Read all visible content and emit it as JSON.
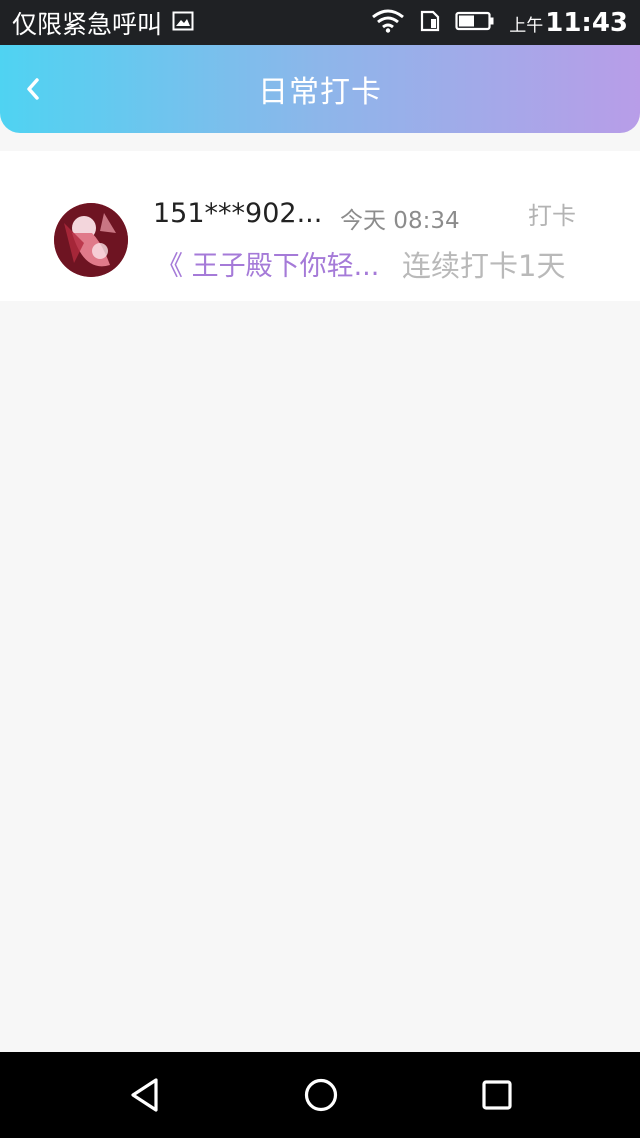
{
  "status_bar": {
    "carrier": "仅限紧急呼叫",
    "period": "上午",
    "time": "11:43",
    "icons": [
      "image-icon",
      "wifi-icon",
      "sim-icon",
      "battery-icon"
    ]
  },
  "header": {
    "title": "日常打卡",
    "back_icon": "chevron-left-icon",
    "gradient_start": "#4fd3f2",
    "gradient_end": "#b89de8"
  },
  "list": {
    "items": [
      {
        "username": "151***902...",
        "time": "今天 08:34",
        "action_label": "打卡",
        "book": "《 王子殿下你轻...",
        "streak": "连续打卡1天"
      }
    ]
  },
  "nav_bar": {
    "icons": [
      "back-triangle-icon",
      "home-circle-icon",
      "recents-square-icon"
    ]
  }
}
